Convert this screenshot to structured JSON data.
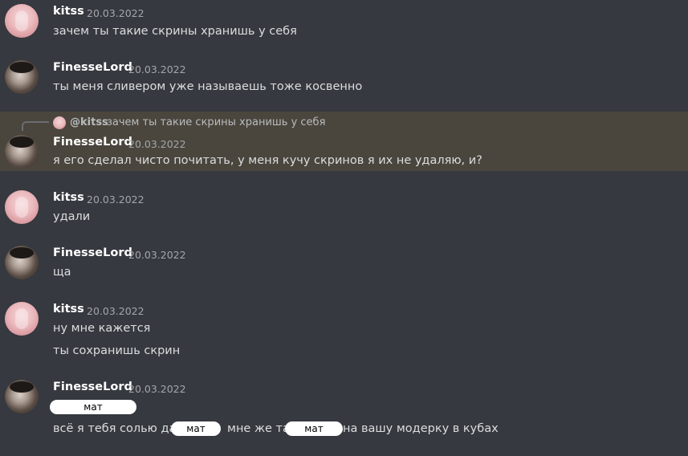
{
  "messages": [
    {
      "author": "kitss",
      "timestamp": "20.03.2022",
      "lines": [
        "зачем ты такие скрины хранишь у себя"
      ]
    },
    {
      "author": "FinesseLord",
      "timestamp": "20.03.2022",
      "lines": [
        "ты меня сливером уже называешь тоже косвенно"
      ]
    },
    {
      "author": "FinesseLord",
      "timestamp": "20.03.2022",
      "lines": [
        "я его сделал чисто почитать, у меня кучу скринов я их не удаляю, и?"
      ],
      "reply": {
        "author": "@kitss",
        "text": "зачем ты такие скрины хранишь у себя"
      }
    },
    {
      "author": "kitss",
      "timestamp": "20.03.2022",
      "lines": [
        "удали"
      ]
    },
    {
      "author": "FinesseLord",
      "timestamp": "20.03.2022",
      "lines": [
        "ща"
      ]
    },
    {
      "author": "kitss",
      "timestamp": "20.03.2022",
      "lines": [
        "ну мне кажется",
        "ты сохранишь скрин"
      ]
    },
    {
      "author": "FinesseLord",
      "timestamp": "20.03.2022",
      "censor_labels": [
        "мат",
        "мат",
        "мат"
      ],
      "last_line_parts": [
        "всё я тебя солью да",
        "мне же так",
        "на вашу модерку в кубах"
      ]
    }
  ],
  "colors": {
    "background": "#36393f",
    "highlight": "#4a463d",
    "username": "#ffffff",
    "text": "#dcddde",
    "timestamp": "#a3a6aa"
  }
}
